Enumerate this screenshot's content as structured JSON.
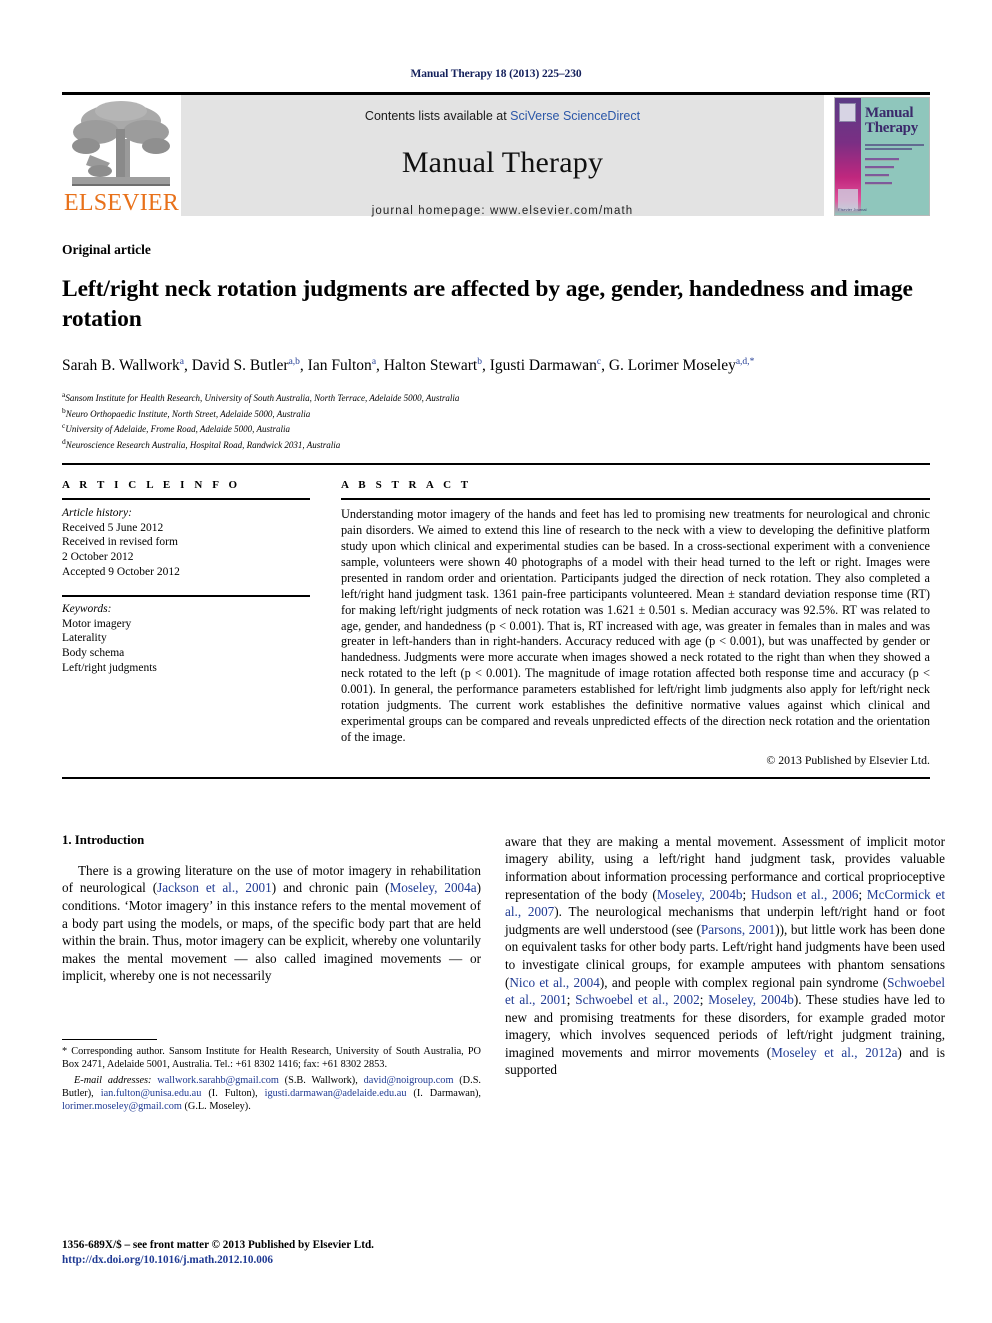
{
  "running_head": "Manual Therapy 18 (2013) 225–230",
  "masthead": {
    "publisher_logo_text": "ELSEVIER",
    "contents_prefix": "Contents lists available at ",
    "contents_link": "SciVerse ScienceDirect",
    "journal_title": "Manual Therapy",
    "homepage_label": "journal homepage: www.elsevier.com/math",
    "cover": {
      "title_line1": "Manual",
      "title_line2": "Therapy",
      "footer_text": "Elsevier\nJournal"
    }
  },
  "article": {
    "type": "Original article",
    "title": "Left/right neck rotation judgments are affected by age, gender, handedness and image rotation",
    "authors_html": "Sarah B. Wallwork<sup>a</sup>, David S. Butler<sup>a,b</sup>, Ian Fulton<sup>a</sup>, Halton Stewart<sup>b</sup>, Igusti Darmawan<sup>c</sup>, G. Lorimer Moseley<sup>a,d,</sup><sup>*</sup>",
    "affiliations": [
      {
        "marker": "a",
        "text": "Sansom Institute for Health Research, University of South Australia, North Terrace, Adelaide 5000, Australia"
      },
      {
        "marker": "b",
        "text": "Neuro Orthopaedic Institute, North Street, Adelaide 5000, Australia"
      },
      {
        "marker": "c",
        "text": "University of Adelaide, Frome Road, Adelaide 5000, Australia"
      },
      {
        "marker": "d",
        "text": "Neuroscience Research Australia, Hospital Road, Randwick 2031, Australia"
      }
    ]
  },
  "article_info": {
    "heading": "A R T I C L E   I N F O",
    "history_label": "Article history:",
    "history": [
      "Received 5 June 2012",
      "Received in revised form",
      "2 October 2012",
      "Accepted 9 October 2012"
    ],
    "keywords_label": "Keywords:",
    "keywords": [
      "Motor imagery",
      "Laterality",
      "Body schema",
      "Left/right judgments"
    ]
  },
  "abstract": {
    "heading": "A B S T R A C T",
    "text": "Understanding motor imagery of the hands and feet has led to promising new treatments for neurological and chronic pain disorders. We aimed to extend this line of research to the neck with a view to developing the definitive platform study upon which clinical and experimental studies can be based. In a cross-sectional experiment with a convenience sample, volunteers were shown 40 photographs of a model with their head turned to the left or right. Images were presented in random order and orientation. Participants judged the direction of neck rotation. They also completed a left/right hand judgment task. 1361 pain-free participants volunteered. Mean ± standard deviation response time (RT) for making left/right judgments of neck rotation was 1.621 ± 0.501 s. Median accuracy was 92.5%. RT was related to age, gender, and handedness (p < 0.001). That is, RT increased with age, was greater in females than in males and was greater in left-handers than in right-handers. Accuracy reduced with age (p < 0.001), but was unaffected by gender or handedness. Judgments were more accurate when images showed a neck rotated to the right than when they showed a neck rotated to the left (p < 0.001). The magnitude of image rotation affected both response time and accuracy (p < 0.001). In general, the performance parameters established for left/right limb judgments also apply for left/right neck rotation judgments. The current work establishes the definitive normative values against which clinical and experimental groups can be compared and reveals unpredicted effects of the direction neck rotation and the orientation of the image.",
    "copyright": "© 2013 Published by Elsevier Ltd."
  },
  "introduction": {
    "heading": "1. Introduction",
    "left_paragraph_html": "There is a growing literature on the use of motor imagery in rehabilitation of neurological (<span class=\"ref\">Jackson et al., 2001</span>) and chronic pain (<span class=\"ref\">Moseley, 2004a</span>) conditions. &#8216;Motor imagery&#8217; in this instance refers to the mental movement of a body part using the models, or maps, of the specific body part that are held within the brain. Thus, motor imagery can be explicit, whereby one voluntarily makes the mental movement &#8212; also called imagined movements &#8212; or implicit, whereby one is not necessarily",
    "right_paragraph_html": "aware that they are making a mental movement. Assessment of implicit motor imagery ability, using a left/right hand judgment task, provides valuable information about information processing performance and cortical proprioceptive representation of the body (<span class=\"ref\">Moseley, 2004b</span>; <span class=\"ref\">Hudson et al., 2006</span>; <span class=\"ref\">McCormick et al., 2007</span>). The neurological mechanisms that underpin left/right hand or foot judgments are well understood (see (<span class=\"ref\">Parsons, 2001</span>)), but little work has been done on equivalent tasks for other body parts. Left/right hand judgments have been used to investigate clinical groups, for example amputees with phantom sensations (<span class=\"ref\">Nico et al., 2004</span>), and people with complex regional pain syndrome (<span class=\"ref\">Schwoebel et al., 2001</span>; <span class=\"ref\">Schwoebel et al., 2002</span>; <span class=\"ref\">Moseley, 2004b</span>). These studies have led to new and promising treatments for these disorders, for example graded motor imagery, which involves sequenced periods of left/right judgment training, imagined movements and mirror movements (<span class=\"ref\">Moseley et al., 2012a</span>) and is supported"
  },
  "footnote": {
    "corresponding_html": "* Corresponding author. Sansom Institute for Health Research, University of South Australia, PO Box 2471, Adelaide 5001, Australia. Tel.: +61 8302 1416; fax: +61 8302 2853.",
    "emails_html": "<span class=\"it\">E-mail addresses:</span> <span class=\"lnk\">wallwork.sarahb@gmail.com</span> (S.B. Wallwork), <span class=\"lnk\">david@noigroup.com</span> (D.S. Butler), <span class=\"lnk\">ian.fulton@unisa.edu.au</span> (I. Fulton), <span class=\"lnk\">igusti.darmawan@adelaide.edu.au</span> (I. Darmawan), <span class=\"lnk\">lorimer.moseley@gmail.com</span> (G.L. Moseley)."
  },
  "footer": {
    "issn_line": "1356-689X/$ – see front matter © 2013 Published by Elsevier Ltd.",
    "doi_line": "http://dx.doi.org/10.1016/j.math.2012.10.006"
  },
  "colors": {
    "link_blue": "#1f3a93",
    "sciencedirect_blue": "#2b57a8",
    "elsevier_orange": "#e8711a",
    "band_gray": "#e3e3e3",
    "runhead_navy": "#14215c"
  }
}
